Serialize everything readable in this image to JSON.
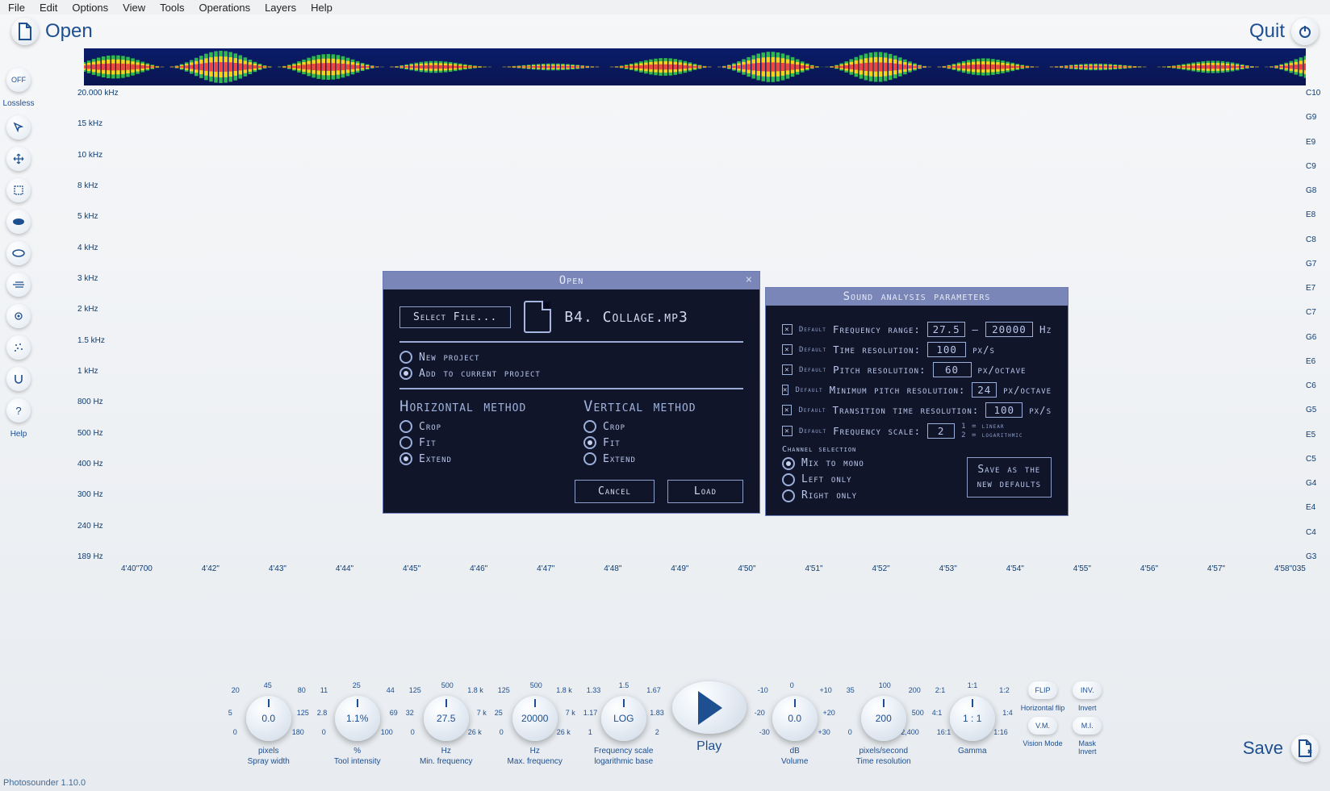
{
  "menu": [
    "File",
    "Edit",
    "Options",
    "View",
    "Tools",
    "Operations",
    "Layers",
    "Help"
  ],
  "topbar": {
    "open": "Open",
    "quit": "Quit"
  },
  "leftTools": {
    "off": "OFF",
    "lossless": "Lossless",
    "help": "Help"
  },
  "yaxis": [
    "20.000 kHz",
    "15 kHz",
    "10 kHz",
    "8 kHz",
    "5 kHz",
    "4 kHz",
    "3 kHz",
    "2 kHz",
    "1.5 kHz",
    "1 kHz",
    "800 Hz",
    "500 Hz",
    "400 Hz",
    "300 Hz",
    "240 Hz",
    "189 Hz"
  ],
  "raxis": [
    "C10",
    "G9",
    "E9",
    "C9",
    "G8",
    "E8",
    "C8",
    "G7",
    "E7",
    "C7",
    "G6",
    "E6",
    "C6",
    "G5",
    "E5",
    "C5",
    "G4",
    "E4",
    "C4",
    "G3"
  ],
  "xaxis": [
    "4'40\"700",
    "4'42\"",
    "4'43\"",
    "4'44\"",
    "4'45\"",
    "4'46\"",
    "4'47\"",
    "4'48\"",
    "4'49\"",
    "4'50\"",
    "4'51\"",
    "4'52\"",
    "4'53\"",
    "4'54\"",
    "4'55\"",
    "4'56\"",
    "4'57\"",
    "4'58\"035"
  ],
  "openDlg": {
    "title": "Open",
    "close": "×",
    "selectFile": "Select File...",
    "filename": "B4. Collage.mp3",
    "newProject": "New project",
    "addToCurrent": "Add to current project",
    "hHeader": "Horizontal method",
    "vHeader": "Vertical method",
    "crop": "Crop",
    "fit": "Fit",
    "extend": "Extend",
    "hSel": "Extend",
    "vSel": "Fit",
    "projSel": "add",
    "cancel": "Cancel",
    "load": "Load"
  },
  "paramDlg": {
    "title": "Sound analysis parameters",
    "default": "Default",
    "freqRange": "Frequency range:",
    "freqMin": "27.5",
    "dash": "–",
    "freqMax": "20000",
    "hz": "Hz",
    "timeRes": "Time resolution:",
    "timeResV": "100",
    "pxs": "px/s",
    "pitchRes": "Pitch resolution:",
    "pitchResV": "60",
    "pxo": "px/octave",
    "minPitch": "Minimum pitch resolution:",
    "minPitchV": "24",
    "transRes": "Transition time resolution:",
    "transResV": "100",
    "freqScale": "Frequency scale:",
    "freqScaleV": "2",
    "scaleNote1": "1 = linear",
    "scaleNote2": "2 = logarithmic",
    "chanHdr": "Channel selection",
    "mix": "Mix to mono",
    "left": "Left only",
    "right": "Right only",
    "chanSel": "mix",
    "saveDef1": "Save as the",
    "saveDef2": "new defaults"
  },
  "knobs": [
    {
      "val": "0.0",
      "l1": "pixels",
      "l2": "Spray width",
      "ticks": {
        "tl": "20",
        "t": "45",
        "tr": "80",
        "l": "5",
        "r": "125",
        "bl": "0",
        "br": "180"
      }
    },
    {
      "val": "1.1%",
      "l1": "%",
      "l2": "Tool intensity",
      "ticks": {
        "tl": "11",
        "t": "25",
        "tr": "44",
        "l": "2.8",
        "r": "69",
        "bl": "0",
        "br": "100"
      }
    },
    {
      "val": "27.5",
      "l1": "Hz",
      "l2": "Min. frequency",
      "ticks": {
        "tl": "125",
        "t": "500",
        "tr": "1.8 k",
        "l": "32",
        "r": "7 k",
        "bl": "0",
        "br": "26 k"
      }
    },
    {
      "val": "20000",
      "l1": "Hz",
      "l2": "Max. frequency",
      "ticks": {
        "tl": "125",
        "t": "500",
        "tr": "1.8 k",
        "l": "25",
        "r": "7 k",
        "bl": "0",
        "br": "26 k"
      }
    },
    {
      "val": "LOG",
      "l1": "Frequency scale",
      "l2": "logarithmic base",
      "ticks": {
        "tl": "1.33",
        "t": "1.5",
        "tr": "1.67",
        "l": "1.17",
        "r": "1.83",
        "bl": "1",
        "br": "2"
      }
    }
  ],
  "play": "Play",
  "knobs2": [
    {
      "val": "0.0",
      "l1": "dB",
      "l2": "Volume",
      "ticks": {
        "tl": "-10",
        "t": "0",
        "tr": "+10",
        "l": "-20",
        "r": "+20",
        "bl": "-30",
        "br": "+30"
      }
    },
    {
      "val": "200",
      "l1": "pixels/second",
      "l2": "Time resolution",
      "ticks": {
        "tl": "35",
        "t": "100",
        "tr": "200",
        "l": "",
        "r": "500",
        "bl": "0",
        "br": "2,400"
      }
    },
    {
      "val": "1 : 1",
      "l1": "Gamma",
      "l2": "",
      "ticks": {
        "tl": "2:1",
        "t": "1:1",
        "tr": "1:2",
        "l": "4:1",
        "r": "1:4",
        "bl": "16:1",
        "br": "1:16"
      }
    }
  ],
  "rightButtons": {
    "flip": "FLIP",
    "hflip": "Horizontal flip",
    "inv": "INV.",
    "invert": "Invert",
    "vm": "V.M.",
    "vmode": "Vision Mode",
    "mi": "M.I.",
    "mask": "Mask",
    "maskInv": "Invert"
  },
  "save": "Save",
  "footer": "Photosounder 1.10.0"
}
